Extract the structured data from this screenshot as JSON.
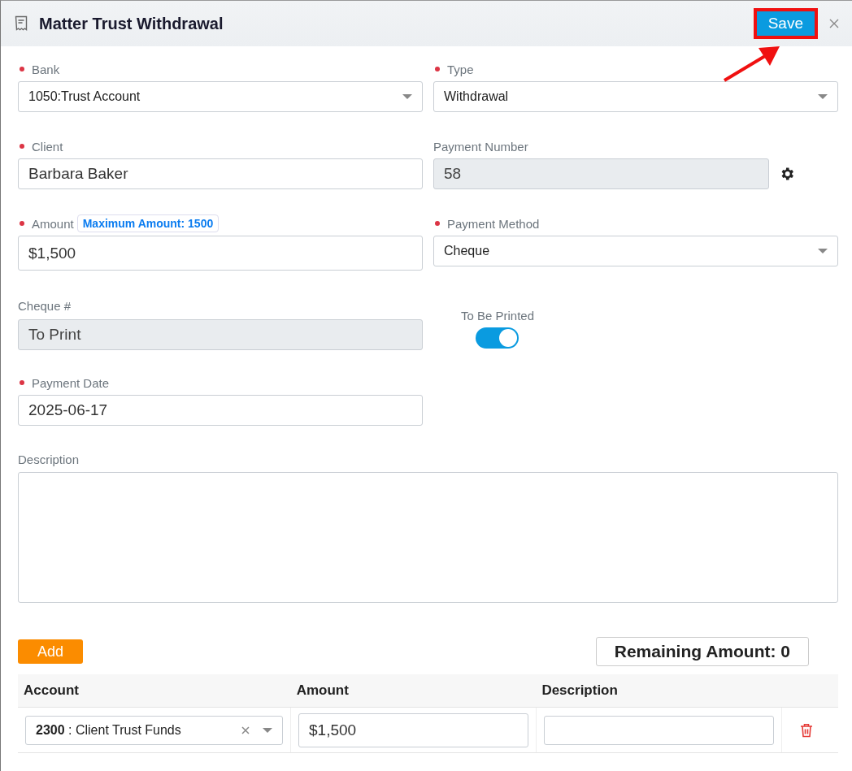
{
  "header": {
    "title": "Matter Trust Withdrawal",
    "save_label": "Save",
    "save_highlighted": true
  },
  "rows": [
    [
      {
        "kind": "select",
        "label": "Bank",
        "required": true,
        "value": "1050:Trust Account"
      },
      {
        "kind": "select",
        "label": "Type",
        "required": true,
        "value": "Withdrawal"
      }
    ],
    [
      {
        "kind": "input",
        "label": "Client",
        "required": true,
        "value": "Barbara Baker"
      },
      {
        "kind": "readonly",
        "label": "Payment Number",
        "required": false,
        "value": "58",
        "settings_button": true
      }
    ],
    [
      {
        "kind": "input",
        "label": "Amount",
        "required": true,
        "value": "$1,500",
        "badge": "Maximum Amount: 1500"
      },
      {
        "kind": "select",
        "label": "Payment Method",
        "required": true,
        "value": "Cheque"
      }
    ],
    [
      {
        "kind": "readonly",
        "label": "Cheque #",
        "required": false,
        "value": "To Print"
      },
      {
        "kind": "toggle",
        "label": "To Be Printed",
        "on": true
      }
    ],
    [
      {
        "kind": "input",
        "label": "Payment Date",
        "required": true,
        "value": "2025-06-17"
      }
    ]
  ],
  "description": {
    "label": "Description"
  },
  "add_label": "Add",
  "remaining": "Remaining Amount: 0",
  "table": {
    "columns": [
      "Account",
      "Amount",
      "Description"
    ],
    "rows": [
      {
        "account": "**2300** : Client Trust Funds",
        "amount": "$1,500"
      }
    ]
  }
}
